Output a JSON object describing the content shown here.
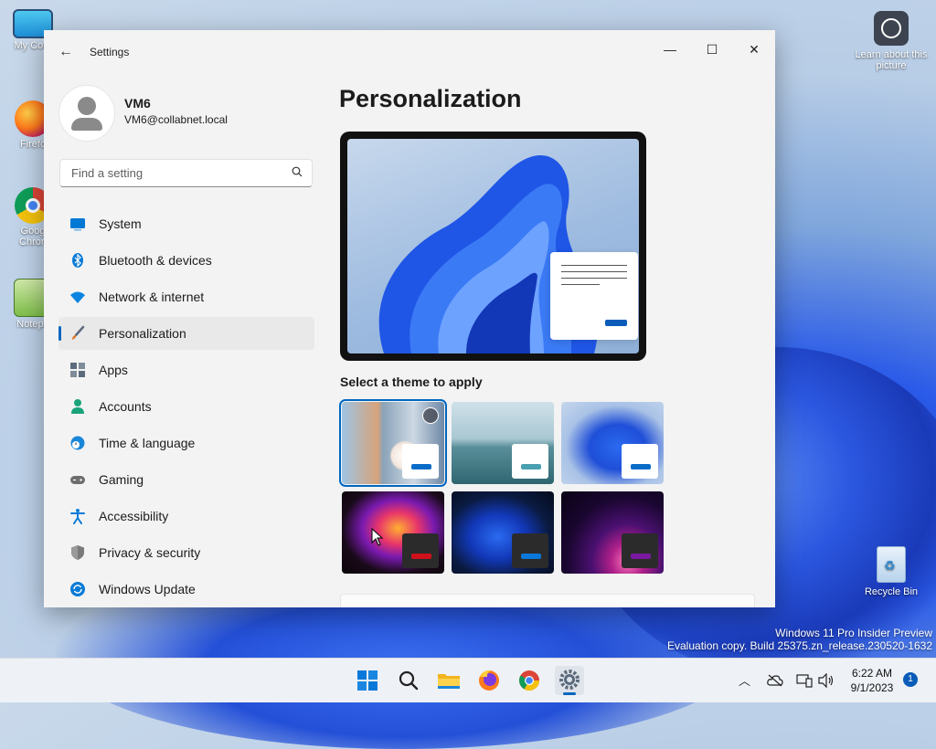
{
  "desktop": {
    "icons_left": [
      {
        "label": "My Com",
        "name": "my-computer"
      },
      {
        "label": "Firefo",
        "name": "firefox"
      },
      {
        "label": "Goog Chron",
        "name": "google-chrome"
      },
      {
        "label": "Notepa",
        "name": "notepad"
      }
    ],
    "learn": "Learn about this picture",
    "recycle": "Recycle Bin",
    "watermark_line1": "Windows 11 Pro Insider Preview",
    "watermark_line2": "Evaluation copy. Build 25375.zn_release.230520-1632"
  },
  "window": {
    "title": "Settings",
    "back_icon": "arrow-left-icon",
    "minimize": "—",
    "maximize": "☐",
    "close": "✕"
  },
  "profile": {
    "name": "VM6",
    "email": "VM6@collabnet.local"
  },
  "search": {
    "placeholder": "Find a setting",
    "value": ""
  },
  "nav": {
    "items": [
      {
        "label": "System",
        "icon": "monitor-icon",
        "color": "#0078d4"
      },
      {
        "label": "Bluetooth & devices",
        "icon": "bluetooth-icon",
        "color": "#0a7bd6"
      },
      {
        "label": "Network & internet",
        "icon": "wifi-icon",
        "color": "#0a84e0"
      },
      {
        "label": "Personalization",
        "icon": "brush-icon",
        "color": "#e07a2e",
        "active": true
      },
      {
        "label": "Apps",
        "icon": "apps-icon",
        "color": "#5b6b7d"
      },
      {
        "label": "Accounts",
        "icon": "person-icon",
        "color": "#1aa37a"
      },
      {
        "label": "Time & language",
        "icon": "globe-clock-icon",
        "color": "#1a86d9"
      },
      {
        "label": "Gaming",
        "icon": "gamepad-icon",
        "color": "#6e6e6e"
      },
      {
        "label": "Accessibility",
        "icon": "accessibility-icon",
        "color": "#0a7bd6"
      },
      {
        "label": "Privacy & security",
        "icon": "shield-icon",
        "color": "#7a7a7a"
      },
      {
        "label": "Windows Update",
        "icon": "update-icon",
        "color": "#0a7bd6"
      }
    ]
  },
  "main": {
    "heading": "Personalization",
    "themes_label": "Select a theme to apply",
    "themes": [
      {
        "name": "theme-flowers-spotlight",
        "selected": true,
        "accent": "#0a6cc8"
      },
      {
        "name": "theme-glow-lake",
        "accent": "#4aa0b0"
      },
      {
        "name": "theme-windows-light",
        "accent": "#0a6cc8"
      },
      {
        "name": "theme-captured-motion",
        "accent": "#d0101a"
      },
      {
        "name": "theme-windows-dark",
        "accent": "#0a78d8"
      },
      {
        "name": "theme-sunrise-purple",
        "accent": "#7a18a0"
      }
    ]
  },
  "taskbar": {
    "apps": [
      "start-icon",
      "search-icon",
      "file-explorer-icon",
      "firefox-icon",
      "chrome-icon",
      "settings-icon"
    ],
    "time": "6:22 AM",
    "date": "9/1/2023",
    "notifications": "1",
    "accent": "#0067c0"
  }
}
